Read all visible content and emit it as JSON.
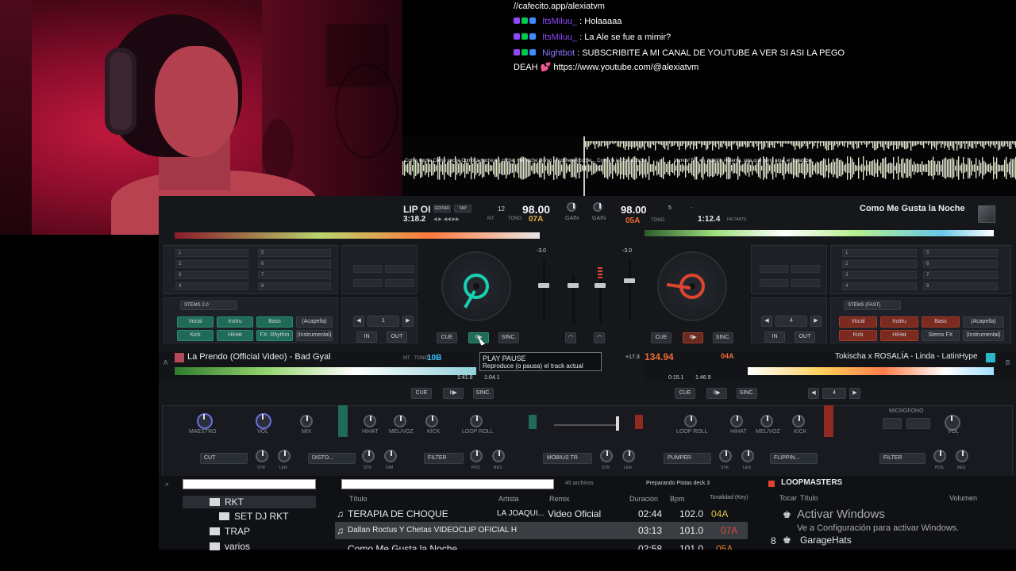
{
  "chat": {
    "lines": [
      {
        "user": "",
        "text": "//cafecito.app/alexiatvm"
      },
      {
        "user": "ItsMiluu_",
        "user_color": "#9147ff",
        "text": ": Holaaaaa"
      },
      {
        "user": "ItsMiluu_",
        "user_color": "#9147ff",
        "text": ": La Ale se fue a mimir?"
      },
      {
        "user": "Nightbot",
        "user_color": "#8a7cff",
        "text": ": SUBSCRIBITE A MI CANAL DE YOUTUBE A VER SI ASI LA PEGO"
      },
      {
        "user": "",
        "text": "DEAH 💕 https://www.youtube.com/@alexiatvm"
      }
    ]
  },
  "overview": {
    "lyrics_a": "Como noche Como noche  Como la noche en coche, me noche  Como la noche en coche...  Como la la cheta coche.",
    "lyrics_b": "Vamos!  Eh, eh, boliche revienta, siga que barra siga, el las arriba."
  },
  "deck_a": {
    "title_short": "LIP OI",
    "time": "3:18.2",
    "bpm": "98.00",
    "pitch_num": "12",
    "key": "07A",
    "key_label": "TONO",
    "mt": "MT",
    "pitch_val": "-3.0",
    "edit": "EDITAR",
    "tap": "TAP",
    "track": "La Prendo (Official Video) - Bad Gyal",
    "key2": "10B",
    "elapsed": "1:41.8",
    "remain": "1:04.1",
    "loop_val": "1",
    "hot_cues_left": [
      "1",
      "2",
      "3",
      "4"
    ],
    "hot_cues_right": [
      "5",
      "6",
      "7",
      "8"
    ],
    "stems_mode": "STEMS 2.0",
    "stems": [
      "Vocal",
      "Instru",
      "Bass",
      "(Acapella)",
      "Kick",
      "HiHat",
      "FX: Rhythm",
      "(Instrumental)"
    ],
    "cue": "CUE",
    "play": "II▶",
    "sync": "SINC.",
    "in": "IN",
    "out": "OUT"
  },
  "deck_b": {
    "track_top": "Como Me Gusta la Noche",
    "bpm": "98.00",
    "pitch_num": "5",
    "key": "05A",
    "key_label": "TONO",
    "time": "1:12.4",
    "faltante": "FALTANTE",
    "pitch_val": "-3.0",
    "track": "Tokischa x ROSALÍA - Linda - LatinHype",
    "bpm2": "134.94",
    "key2": "04A",
    "elapsed": "0:15.1",
    "remain": "1:46.9",
    "loop_val": "4",
    "hot_cues_left": [
      "1",
      "2",
      "3",
      "4"
    ],
    "hot_cues_right": [
      "5",
      "6",
      "7",
      "8"
    ],
    "stems_mode": "STEMS (FAST)",
    "stems": [
      "Vocal",
      "Instru",
      "Bass",
      "(Acapella)",
      "Kick",
      "HiHat",
      "Stems FX",
      "(Instrumental)"
    ],
    "cue": "CUE",
    "play": "II▶",
    "sync": "SINC.",
    "in": "IN",
    "out": "OUT"
  },
  "mixer": {
    "gain": "GAIN",
    "tooltip_title": "PLAY PAUSE",
    "tooltip_desc": "Reproduce (o pausa) el track actual",
    "pitch_a": "+17.3",
    "fx_labels": [
      "MAESTRO",
      "VOL",
      "MIX",
      "HIHAT",
      "MEL/VOZ",
      "KICK",
      "LOOP ROLL",
      "LOOP ROLL",
      "HIHAT",
      "MEL/VOZ",
      "KICK",
      "VOL"
    ],
    "microfono": "MICRÓFONO",
    "fx_selects": [
      "CUT",
      "DISTO...",
      "FILTER",
      "MOBIUS TR",
      "PUMPER",
      "FLIPPIN...",
      "FILTER"
    ],
    "knob_small": [
      "STR",
      "LEN",
      "STR",
      "DIM",
      "POS",
      "RES",
      "STR",
      "LEN",
      "STR",
      "LEN",
      "POS",
      "RES"
    ]
  },
  "browser": {
    "folders": [
      "RKT",
      "SET DJ RKT",
      "TRAP",
      "varios"
    ],
    "count": "45 archivos",
    "status": "Preparando Pistas deck 3",
    "columns": [
      "Título",
      "Artista",
      "Remix",
      "Duración",
      "Bpm",
      "Tonalidad (Key)"
    ],
    "rows": [
      {
        "title": "TERAPIA DE CHOQUE",
        "artist": "LA JOAQUI...",
        "remix": "Video Oficial",
        "duration": "02:44",
        "bpm": "102.0",
        "key": "04A",
        "key_color": "#e2c24a"
      },
      {
        "title": "Dallan Roctus Y Chetas VIDEOCLIP OFICIAL H",
        "artist": "",
        "remix": "",
        "duration": "03:13",
        "bpm": "101.0",
        "key": "07A",
        "key_color": "#d9483c"
      },
      {
        "title": "Como Me Gusta la Noche",
        "artist": "",
        "remix": "",
        "duration": "02:58",
        "bpm": "101.0",
        "key": "05A",
        "key_color": "#e57b30"
      }
    ],
    "side_title": "LOOPMASTERS",
    "side_cols": [
      "Tocar",
      "Título",
      "Volumen"
    ],
    "side_rows": [
      {
        "num": "",
        "name": ""
      },
      {
        "num": "8",
        "name": "GarageHats"
      }
    ]
  },
  "windows": {
    "title": "Activar Windows",
    "sub": "Ve a Configuración para activar Windows."
  },
  "colors": {
    "accent_a": "#17d1b0",
    "accent_b": "#e0442f",
    "loop_key_a": "#3ec6ff"
  }
}
